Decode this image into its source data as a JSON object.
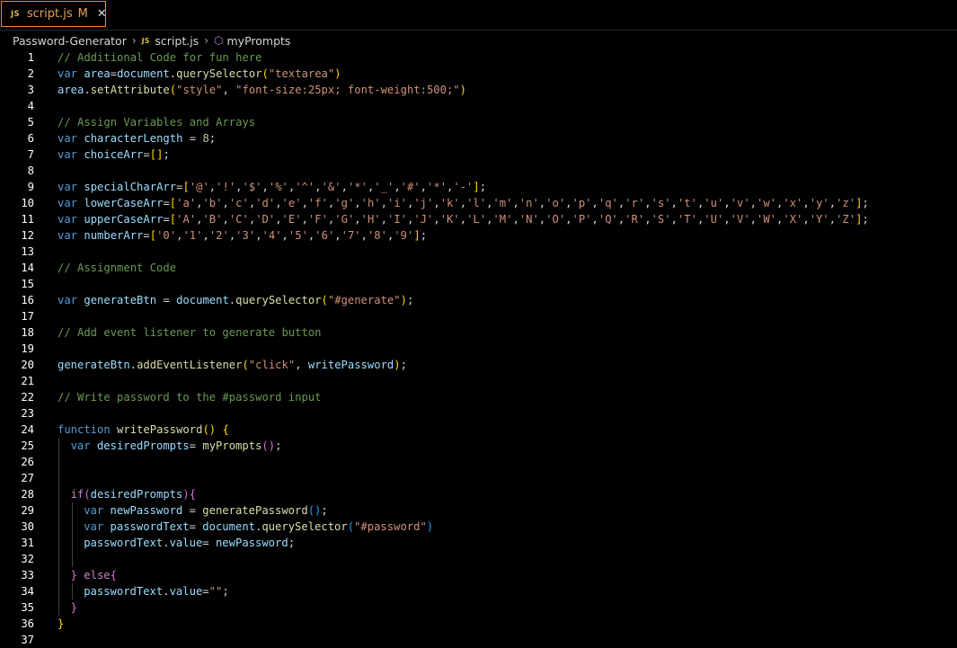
{
  "tab": {
    "icon": "js-file-icon",
    "icon_text": "JS",
    "title": "script.js",
    "modified": "M",
    "close": "✕"
  },
  "breadcrumb": [
    {
      "label": "Password-Generator",
      "icon": ""
    },
    {
      "label": "script.js",
      "icon": "js-file-icon",
      "icon_text": "JS"
    },
    {
      "label": "myPrompts",
      "icon": "symbol-method-icon"
    }
  ],
  "colors": {
    "tab_border": "#f0883e",
    "comment": "#6a9955",
    "keyword": "#569cd6",
    "control": "#c586c0",
    "variable": "#9cdcfe",
    "function": "#dcdcaa",
    "string": "#ce9178",
    "number": "#b5cea8"
  },
  "code_lines": [
    {
      "n": "1",
      "indent": 0,
      "tokens": [
        [
          "// Additional Code for fun here",
          "comment"
        ]
      ]
    },
    {
      "n": "2",
      "indent": 0,
      "tokens": [
        [
          "var ",
          "kw"
        ],
        [
          "area",
          "var"
        ],
        [
          "=",
          "plain"
        ],
        [
          "document",
          "var"
        ],
        [
          ".",
          "plain"
        ],
        [
          "querySelector",
          "fn"
        ],
        [
          "(",
          "b1"
        ],
        [
          "\"textarea\"",
          "str"
        ],
        [
          ")",
          "b1"
        ]
      ]
    },
    {
      "n": "3",
      "indent": 0,
      "tokens": [
        [
          "area",
          "var"
        ],
        [
          ".",
          "plain"
        ],
        [
          "setAttribute",
          "fn"
        ],
        [
          "(",
          "b1"
        ],
        [
          "\"style\"",
          "str"
        ],
        [
          ", ",
          "plain"
        ],
        [
          "\"font-size:25px; font-weight:500;\"",
          "str"
        ],
        [
          ")",
          "b1"
        ]
      ]
    },
    {
      "n": "4",
      "indent": 0,
      "tokens": []
    },
    {
      "n": "5",
      "indent": 0,
      "tokens": [
        [
          "// Assign Variables and Arrays",
          "comment"
        ]
      ]
    },
    {
      "n": "6",
      "indent": 0,
      "tokens": [
        [
          "var ",
          "kw"
        ],
        [
          "characterLength",
          "var"
        ],
        [
          " = ",
          "plain"
        ],
        [
          "8",
          "num"
        ],
        [
          ";",
          "plain"
        ]
      ]
    },
    {
      "n": "7",
      "indent": 0,
      "tokens": [
        [
          "var ",
          "kw"
        ],
        [
          "choiceArr",
          "var"
        ],
        [
          "=",
          "plain"
        ],
        [
          "[]",
          "b1"
        ],
        [
          ";",
          "plain"
        ]
      ]
    },
    {
      "n": "8",
      "indent": 0,
      "tokens": []
    },
    {
      "n": "9",
      "indent": 0,
      "tokens": [
        [
          "var ",
          "kw"
        ],
        [
          "specialCharArr",
          "var"
        ],
        [
          "=",
          "plain"
        ],
        [
          "[",
          "b1"
        ],
        [
          "'@'",
          "str"
        ],
        [
          ",",
          "plain"
        ],
        [
          "'!'",
          "str"
        ],
        [
          ",",
          "plain"
        ],
        [
          "'$'",
          "str"
        ],
        [
          ",",
          "plain"
        ],
        [
          "'%'",
          "str"
        ],
        [
          ",",
          "plain"
        ],
        [
          "'^'",
          "str"
        ],
        [
          ",",
          "plain"
        ],
        [
          "'&'",
          "str"
        ],
        [
          ",",
          "plain"
        ],
        [
          "'*'",
          "str"
        ],
        [
          ",",
          "plain"
        ],
        [
          "'_'",
          "str"
        ],
        [
          ",",
          "plain"
        ],
        [
          "'#'",
          "str"
        ],
        [
          ",",
          "plain"
        ],
        [
          "'*'",
          "str"
        ],
        [
          ",",
          "plain"
        ],
        [
          "'-'",
          "str"
        ],
        [
          "]",
          "b1"
        ],
        [
          ";",
          "plain"
        ]
      ]
    },
    {
      "n": "10",
      "indent": 0,
      "tokens": [
        [
          "var ",
          "kw"
        ],
        [
          "lowerCaseArr",
          "var"
        ],
        [
          "=",
          "plain"
        ],
        [
          "[",
          "b1"
        ],
        [
          "'a'",
          "str"
        ],
        [
          ",",
          "plain"
        ],
        [
          "'b'",
          "str"
        ],
        [
          ",",
          "plain"
        ],
        [
          "'c'",
          "str"
        ],
        [
          ",",
          "plain"
        ],
        [
          "'d'",
          "str"
        ],
        [
          ",",
          "plain"
        ],
        [
          "'e'",
          "str"
        ],
        [
          ",",
          "plain"
        ],
        [
          "'f'",
          "str"
        ],
        [
          ",",
          "plain"
        ],
        [
          "'g'",
          "str"
        ],
        [
          ",",
          "plain"
        ],
        [
          "'h'",
          "str"
        ],
        [
          ",",
          "plain"
        ],
        [
          "'i'",
          "str"
        ],
        [
          ",",
          "plain"
        ],
        [
          "'j'",
          "str"
        ],
        [
          ",",
          "plain"
        ],
        [
          "'k'",
          "str"
        ],
        [
          ",",
          "plain"
        ],
        [
          "'l'",
          "str"
        ],
        [
          ",",
          "plain"
        ],
        [
          "'m'",
          "str"
        ],
        [
          ",",
          "plain"
        ],
        [
          "'n'",
          "str"
        ],
        [
          ",",
          "plain"
        ],
        [
          "'o'",
          "str"
        ],
        [
          ",",
          "plain"
        ],
        [
          "'p'",
          "str"
        ],
        [
          ",",
          "plain"
        ],
        [
          "'q'",
          "str"
        ],
        [
          ",",
          "plain"
        ],
        [
          "'r'",
          "str"
        ],
        [
          ",",
          "plain"
        ],
        [
          "'s'",
          "str"
        ],
        [
          ",",
          "plain"
        ],
        [
          "'t'",
          "str"
        ],
        [
          ",",
          "plain"
        ],
        [
          "'u'",
          "str"
        ],
        [
          ",",
          "plain"
        ],
        [
          "'v'",
          "str"
        ],
        [
          ",",
          "plain"
        ],
        [
          "'w'",
          "str"
        ],
        [
          ",",
          "plain"
        ],
        [
          "'x'",
          "str"
        ],
        [
          ",",
          "plain"
        ],
        [
          "'y'",
          "str"
        ],
        [
          ",",
          "plain"
        ],
        [
          "'z'",
          "str"
        ],
        [
          "]",
          "b1"
        ],
        [
          ";",
          "plain"
        ]
      ]
    },
    {
      "n": "11",
      "indent": 0,
      "tokens": [
        [
          "var ",
          "kw"
        ],
        [
          "upperCaseArr",
          "var"
        ],
        [
          "=",
          "plain"
        ],
        [
          "[",
          "b1"
        ],
        [
          "'A'",
          "str"
        ],
        [
          ",",
          "plain"
        ],
        [
          "'B'",
          "str"
        ],
        [
          ",",
          "plain"
        ],
        [
          "'C'",
          "str"
        ],
        [
          ",",
          "plain"
        ],
        [
          "'D'",
          "str"
        ],
        [
          ",",
          "plain"
        ],
        [
          "'E'",
          "str"
        ],
        [
          ",",
          "plain"
        ],
        [
          "'F'",
          "str"
        ],
        [
          ",",
          "plain"
        ],
        [
          "'G'",
          "str"
        ],
        [
          ",",
          "plain"
        ],
        [
          "'H'",
          "str"
        ],
        [
          ",",
          "plain"
        ],
        [
          "'I'",
          "str"
        ],
        [
          ",",
          "plain"
        ],
        [
          "'J'",
          "str"
        ],
        [
          ",",
          "plain"
        ],
        [
          "'K'",
          "str"
        ],
        [
          ",",
          "plain"
        ],
        [
          "'L'",
          "str"
        ],
        [
          ",",
          "plain"
        ],
        [
          "'M'",
          "str"
        ],
        [
          ",",
          "plain"
        ],
        [
          "'N'",
          "str"
        ],
        [
          ",",
          "plain"
        ],
        [
          "'O'",
          "str"
        ],
        [
          ",",
          "plain"
        ],
        [
          "'P'",
          "str"
        ],
        [
          ",",
          "plain"
        ],
        [
          "'Q'",
          "str"
        ],
        [
          ",",
          "plain"
        ],
        [
          "'R'",
          "str"
        ],
        [
          ",",
          "plain"
        ],
        [
          "'S'",
          "str"
        ],
        [
          ",",
          "plain"
        ],
        [
          "'T'",
          "str"
        ],
        [
          ",",
          "plain"
        ],
        [
          "'U'",
          "str"
        ],
        [
          ",",
          "plain"
        ],
        [
          "'V'",
          "str"
        ],
        [
          ",",
          "plain"
        ],
        [
          "'W'",
          "str"
        ],
        [
          ",",
          "plain"
        ],
        [
          "'X'",
          "str"
        ],
        [
          ",",
          "plain"
        ],
        [
          "'Y'",
          "str"
        ],
        [
          ",",
          "plain"
        ],
        [
          "'Z'",
          "str"
        ],
        [
          "]",
          "b1"
        ],
        [
          ";",
          "plain"
        ]
      ]
    },
    {
      "n": "12",
      "indent": 0,
      "tokens": [
        [
          "var ",
          "kw"
        ],
        [
          "numberArr",
          "var"
        ],
        [
          "=",
          "plain"
        ],
        [
          "[",
          "b1"
        ],
        [
          "'0'",
          "str"
        ],
        [
          ",",
          "plain"
        ],
        [
          "'1'",
          "str"
        ],
        [
          ",",
          "plain"
        ],
        [
          "'2'",
          "str"
        ],
        [
          ",",
          "plain"
        ],
        [
          "'3'",
          "str"
        ],
        [
          ",",
          "plain"
        ],
        [
          "'4'",
          "str"
        ],
        [
          ",",
          "plain"
        ],
        [
          "'5'",
          "str"
        ],
        [
          ",",
          "plain"
        ],
        [
          "'6'",
          "str"
        ],
        [
          ",",
          "plain"
        ],
        [
          "'7'",
          "str"
        ],
        [
          ",",
          "plain"
        ],
        [
          "'8'",
          "str"
        ],
        [
          ",",
          "plain"
        ],
        [
          "'9'",
          "str"
        ],
        [
          "]",
          "b1"
        ],
        [
          ";",
          "plain"
        ]
      ]
    },
    {
      "n": "13",
      "indent": 0,
      "tokens": []
    },
    {
      "n": "14",
      "indent": 0,
      "tokens": [
        [
          "// Assignment Code",
          "comment"
        ]
      ]
    },
    {
      "n": "15",
      "indent": 0,
      "tokens": []
    },
    {
      "n": "16",
      "indent": 0,
      "tokens": [
        [
          "var ",
          "kw"
        ],
        [
          "generateBtn",
          "var"
        ],
        [
          " = ",
          "plain"
        ],
        [
          "document",
          "var"
        ],
        [
          ".",
          "plain"
        ],
        [
          "querySelector",
          "fn"
        ],
        [
          "(",
          "b1"
        ],
        [
          "\"#generate\"",
          "str"
        ],
        [
          ")",
          "b1"
        ],
        [
          ";",
          "plain"
        ]
      ]
    },
    {
      "n": "17",
      "indent": 0,
      "tokens": []
    },
    {
      "n": "18",
      "indent": 0,
      "tokens": [
        [
          "// Add event listener to generate button",
          "comment"
        ]
      ]
    },
    {
      "n": "19",
      "indent": 0,
      "tokens": []
    },
    {
      "n": "20",
      "indent": 0,
      "tokens": [
        [
          "generateBtn",
          "var"
        ],
        [
          ".",
          "plain"
        ],
        [
          "addEventListener",
          "fn"
        ],
        [
          "(",
          "b1"
        ],
        [
          "\"click\"",
          "str"
        ],
        [
          ", ",
          "plain"
        ],
        [
          "writePassword",
          "var"
        ],
        [
          ")",
          "b1"
        ],
        [
          ";",
          "plain"
        ]
      ]
    },
    {
      "n": "21",
      "indent": 0,
      "tokens": []
    },
    {
      "n": "22",
      "indent": 0,
      "tokens": [
        [
          "// Write password to the #password input",
          "comment"
        ]
      ]
    },
    {
      "n": "23",
      "indent": 0,
      "tokens": []
    },
    {
      "n": "24",
      "indent": 0,
      "tokens": [
        [
          "function ",
          "kw"
        ],
        [
          "writePassword",
          "fn"
        ],
        [
          "()",
          "b1"
        ],
        [
          " ",
          "plain"
        ],
        [
          "{",
          "b1"
        ]
      ]
    },
    {
      "n": "25",
      "indent": 1,
      "tokens": [
        [
          "var ",
          "kw"
        ],
        [
          "desiredPrompts",
          "var"
        ],
        [
          "= ",
          "plain"
        ],
        [
          "myPrompts",
          "fn"
        ],
        [
          "()",
          "b2"
        ],
        [
          ";",
          "plain"
        ]
      ]
    },
    {
      "n": "26",
      "indent": 1,
      "tokens": []
    },
    {
      "n": "27",
      "indent": 1,
      "tokens": []
    },
    {
      "n": "28",
      "indent": 1,
      "tokens": [
        [
          "if",
          "ctrl"
        ],
        [
          "(",
          "b2"
        ],
        [
          "desiredPrompts",
          "var"
        ],
        [
          ")",
          "b2"
        ],
        [
          "{",
          "b2"
        ]
      ]
    },
    {
      "n": "29",
      "indent": 2,
      "tokens": [
        [
          "var ",
          "kw"
        ],
        [
          "newPassword",
          "var"
        ],
        [
          " = ",
          "plain"
        ],
        [
          "generatePassword",
          "fn"
        ],
        [
          "()",
          "b3"
        ],
        [
          ";",
          "plain"
        ]
      ]
    },
    {
      "n": "30",
      "indent": 2,
      "tokens": [
        [
          "var ",
          "kw"
        ],
        [
          "passwordText",
          "var"
        ],
        [
          "= ",
          "plain"
        ],
        [
          "document",
          "var"
        ],
        [
          ".",
          "plain"
        ],
        [
          "querySelector",
          "fn"
        ],
        [
          "(",
          "b3"
        ],
        [
          "\"#password\"",
          "str"
        ],
        [
          ")",
          "b3"
        ]
      ]
    },
    {
      "n": "31",
      "indent": 2,
      "tokens": [
        [
          "passwordText",
          "var"
        ],
        [
          ".",
          "plain"
        ],
        [
          "value",
          "var"
        ],
        [
          "= ",
          "plain"
        ],
        [
          "newPassword",
          "var"
        ],
        [
          ";",
          "plain"
        ]
      ]
    },
    {
      "n": "32",
      "indent": 2,
      "tokens": []
    },
    {
      "n": "33",
      "indent": 1,
      "tokens": [
        [
          "} ",
          "b2"
        ],
        [
          "else",
          "ctrl"
        ],
        [
          "{",
          "b2"
        ]
      ]
    },
    {
      "n": "34",
      "indent": 2,
      "tokens": [
        [
          "passwordText",
          "var"
        ],
        [
          ".",
          "plain"
        ],
        [
          "value",
          "var"
        ],
        [
          "=",
          "plain"
        ],
        [
          "\"\"",
          "str"
        ],
        [
          ";",
          "plain"
        ]
      ]
    },
    {
      "n": "35",
      "indent": 1,
      "tokens": [
        [
          "}",
          "b2"
        ]
      ]
    },
    {
      "n": "36",
      "indent": 0,
      "tokens": [
        [
          "}",
          "b1"
        ]
      ]
    },
    {
      "n": "37",
      "indent": 0,
      "tokens": []
    }
  ]
}
